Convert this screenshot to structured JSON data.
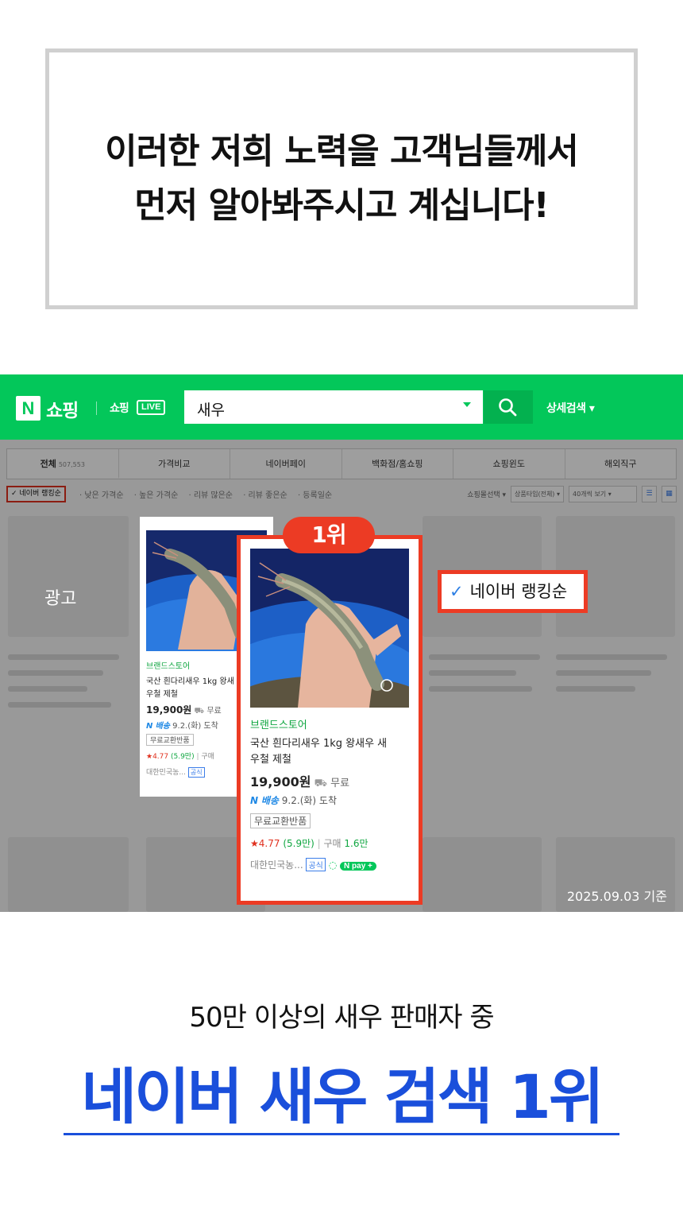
{
  "headline": {
    "line1": "이러한 저희 노력을 고객님들께서",
    "line2": "먼저 알아봐주시고 계십니다!"
  },
  "naver": {
    "logo": "N",
    "shopping": "쇼핑",
    "live_text": "쇼핑",
    "live_badge": "LIVE",
    "search_value": "새우",
    "detail_search": "상세검색 ▾",
    "tabs": [
      {
        "label": "전체",
        "count": "507,553"
      },
      {
        "label": "가격비교"
      },
      {
        "label": "네이버페이"
      },
      {
        "label": "백화점/홈쇼핑"
      },
      {
        "label": "쇼핑윈도"
      },
      {
        "label": "해외직구"
      }
    ],
    "sort_active": "✓ 네이버 랭킹순",
    "sort_options": [
      "· 낮은 가격순",
      "· 높은 가격순",
      "· 리뷰 많은순",
      "· 리뷰 좋은순",
      "· 등록일순"
    ],
    "mall_select": "쇼핑몰선택 ▾",
    "product_type": "상품타입(전체) ▾",
    "view_count": "40개씩 보기 ▾",
    "ad_label": "광고"
  },
  "product": {
    "store": "브랜드스토어",
    "name_line1": "국산 흰다리새우 1kg 왕새우 새",
    "name_line2": "우철 제철",
    "small_name_line1": "국산 흰다리새우 1kg 왕새",
    "small_name_line2": "우철 제철",
    "price": "19,900원",
    "shipping": "무료",
    "delivery_brand": "배송",
    "delivery_date": "9.2.(화) 도착",
    "tag": "무료교환반품",
    "rating": "★4.77",
    "reviews": "(5.9만)",
    "purchase_label": "구매",
    "purchase_count": "1.6만",
    "seller": "대한민국농...",
    "official": "공식",
    "npay": "N pay +"
  },
  "rank_badge": "1위",
  "callout": {
    "check": "✓",
    "label": "네이버 랭킹순"
  },
  "date_note": "2025.09.03 기준",
  "bottom": {
    "subtitle": "50만 이상의 새우 판매자 중",
    "title": "네이버 새우 검색 1위"
  },
  "colors": {
    "naver_green": "#03c75a",
    "highlight_red": "#ec3b24",
    "title_blue": "#1a4fdb"
  }
}
